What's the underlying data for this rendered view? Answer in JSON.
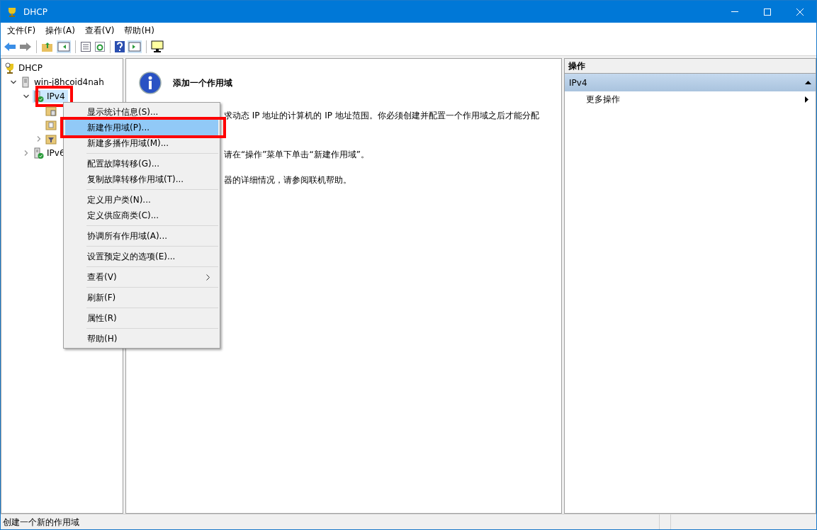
{
  "window": {
    "title": "DHCP"
  },
  "menu_bar": [
    "文件(F)",
    "操作(A)",
    "查看(V)",
    "帮助(H)"
  ],
  "tree": [
    {
      "label": "DHCP",
      "kind": "root",
      "selected": false,
      "annotated": false,
      "children": [
        {
          "label": "win-j8hcoid4nah",
          "kind": "server",
          "expanded": true,
          "selected": false,
          "annotated": false,
          "children": [
            {
              "label": "IPv4",
              "kind": "protocol",
              "expanded": true,
              "selected": true,
              "annotated": true,
              "children": [
                {
                  "kind": "folder",
                  "expandable": false
                },
                {
                  "kind": "page-folder",
                  "expandable": false
                },
                {
                  "kind": "filter-folder",
                  "expandable": true
                }
              ]
            },
            {
              "label": "IPv6",
              "kind": "protocol",
              "expanded": false,
              "selected": false,
              "annotated": false
            }
          ]
        }
      ]
    }
  ],
  "content": {
    "heading": "添加一个作用域",
    "paragraphs": [
      "求动态 IP 地址的计算机的 IP 地址范围。你必须创建并配置一个作用域之后才能分配",
      "请在“操作”菜单下单击“新建作用域”。",
      "器的详细情况，请参阅联机帮助。"
    ]
  },
  "context_menu": [
    {
      "kind": "item",
      "label": "显示统计信息(S)...",
      "selected": false,
      "annotated": false,
      "submenu": false
    },
    {
      "kind": "item",
      "label": "新建作用域(P)...",
      "selected": true,
      "annotated": true,
      "submenu": false
    },
    {
      "kind": "item",
      "label": "新建多播作用域(M)...",
      "selected": false,
      "annotated": false,
      "submenu": false
    },
    {
      "kind": "separator"
    },
    {
      "kind": "item",
      "label": "配置故障转移(G)...",
      "selected": false,
      "annotated": false,
      "submenu": false
    },
    {
      "kind": "item",
      "label": "复制故障转移作用域(T)...",
      "selected": false,
      "annotated": false,
      "submenu": false
    },
    {
      "kind": "separator"
    },
    {
      "kind": "item",
      "label": "定义用户类(N)...",
      "selected": false,
      "annotated": false,
      "submenu": false
    },
    {
      "kind": "item",
      "label": "定义供应商类(C)...",
      "selected": false,
      "annotated": false,
      "submenu": false
    },
    {
      "kind": "separator"
    },
    {
      "kind": "item",
      "label": "协调所有作用域(A)...",
      "selected": false,
      "annotated": false,
      "submenu": false
    },
    {
      "kind": "separator"
    },
    {
      "kind": "item",
      "label": "设置预定义的选项(E)...",
      "selected": false,
      "annotated": false,
      "submenu": false
    },
    {
      "kind": "separator"
    },
    {
      "kind": "item",
      "label": "查看(V)",
      "selected": false,
      "annotated": false,
      "submenu": true
    },
    {
      "kind": "separator"
    },
    {
      "kind": "item",
      "label": "刷新(F)",
      "selected": false,
      "annotated": false,
      "submenu": false
    },
    {
      "kind": "separator"
    },
    {
      "kind": "item",
      "label": "属性(R)",
      "selected": false,
      "annotated": false,
      "submenu": false
    },
    {
      "kind": "separator"
    },
    {
      "kind": "item",
      "label": "帮助(H)",
      "selected": false,
      "annotated": false,
      "submenu": false
    }
  ],
  "actions": {
    "title": "操作",
    "sections": [
      {
        "label": "IPv4",
        "expanded": true,
        "items": [
          {
            "label": "更多操作",
            "submenu": true
          }
        ]
      }
    ]
  },
  "status_bar": "创建一个新的作用域"
}
